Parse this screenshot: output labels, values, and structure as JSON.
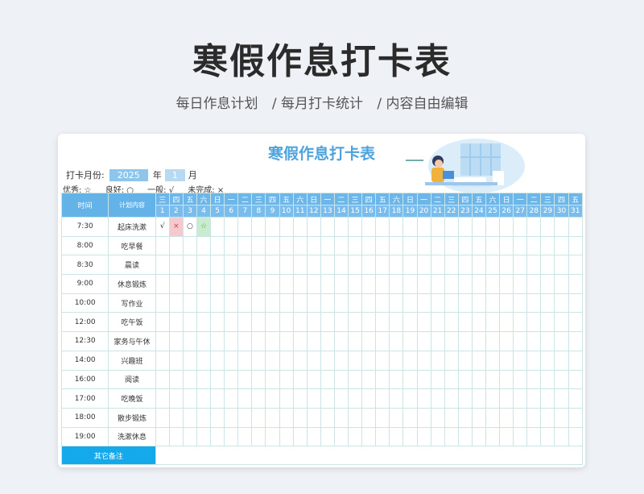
{
  "page": {
    "title": "寒假作息打卡表",
    "subtitle": [
      "每日作息计划",
      "/ 每月打卡统计",
      "/ 内容自由编辑"
    ]
  },
  "sheet": {
    "title": "寒假作息打卡表",
    "month_label": "打卡月份:",
    "year": "2025",
    "year_unit": "年",
    "month": "1",
    "month_unit": "月",
    "legend": [
      "优秀: ☆",
      "良好: ○",
      "一般: √",
      "未完成: ×"
    ],
    "headers": {
      "time": "时间",
      "plan": "计划内容"
    },
    "weekdays": [
      "三",
      "四",
      "五",
      "六",
      "日",
      "一",
      "二",
      "三",
      "四",
      "五",
      "六",
      "日",
      "一",
      "二",
      "三",
      "四",
      "五",
      "六",
      "日",
      "一",
      "二",
      "三",
      "四",
      "五",
      "六",
      "日",
      "一",
      "二",
      "三",
      "四",
      "五"
    ],
    "days": [
      "1",
      "2",
      "3",
      "4",
      "5",
      "6",
      "7",
      "8",
      "9",
      "10",
      "11",
      "12",
      "13",
      "14",
      "15",
      "16",
      "17",
      "18",
      "19",
      "20",
      "21",
      "22",
      "23",
      "24",
      "25",
      "26",
      "27",
      "28",
      "29",
      "30",
      "31"
    ],
    "rows": [
      {
        "time": "7:30",
        "plan": "起床洗漱",
        "marks": [
          "√",
          "×",
          "○",
          "☆"
        ]
      },
      {
        "time": "8:00",
        "plan": "吃早餐",
        "marks": []
      },
      {
        "time": "8:30",
        "plan": "晨读",
        "marks": []
      },
      {
        "time": "9:00",
        "plan": "休息锻炼",
        "marks": []
      },
      {
        "time": "10:00",
        "plan": "写作业",
        "marks": []
      },
      {
        "time": "12:00",
        "plan": "吃午饭",
        "marks": []
      },
      {
        "time": "12:30",
        "plan": "家务与午休",
        "marks": []
      },
      {
        "time": "14:00",
        "plan": "兴趣班",
        "marks": []
      },
      {
        "time": "16:00",
        "plan": "阅读",
        "marks": []
      },
      {
        "time": "17:00",
        "plan": "吃晚饭",
        "marks": []
      },
      {
        "time": "18:00",
        "plan": "散步锻炼",
        "marks": []
      },
      {
        "time": "19:00",
        "plan": "洗漱休息",
        "marks": []
      }
    ],
    "notes_label": "其它备注"
  },
  "colors": {
    "accent": "#4fa3dc",
    "header": "#63b2e8",
    "note": "#14a9ea"
  }
}
